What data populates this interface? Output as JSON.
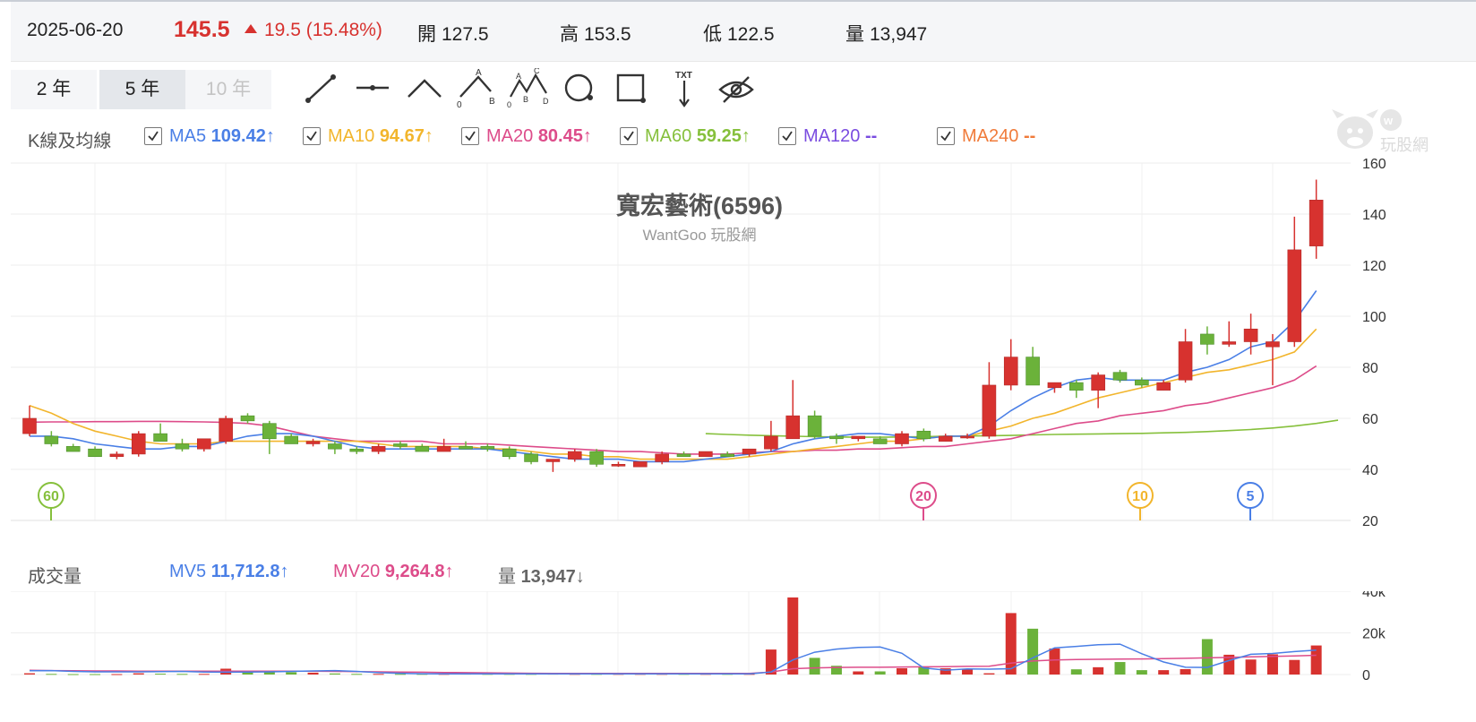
{
  "header": {
    "date": "2025-06-20",
    "price": "145.5",
    "change": "19.5 (15.48%)",
    "open_label": "開",
    "open_value": "127.5",
    "high_label": "高",
    "high_value": "153.5",
    "low_label": "低",
    "low_value": "122.5",
    "volume_label": "量",
    "volume_value": "13,947"
  },
  "range_buttons": {
    "two_year": "2 年",
    "five_year": "5 年",
    "ten_year": "10 年"
  },
  "colors": {
    "up": "#d7322f",
    "down": "#6bb23a",
    "ma5": "#4a7fe6",
    "ma10": "#f2b52c",
    "ma20": "#dd4c8a",
    "ma60": "#86c03c",
    "ma120": "#7a4ce0",
    "ma240": "#f07b3a"
  },
  "legend": {
    "title": "K線及均線",
    "ma5_label": "MA5",
    "ma5_value": "109.42",
    "ma5_arrow": "↑",
    "ma10_label": "MA10",
    "ma10_value": "94.67",
    "ma10_arrow": "↑",
    "ma20_label": "MA20",
    "ma20_value": "80.45",
    "ma20_arrow": "↑",
    "ma60_label": "MA60",
    "ma60_value": "59.25",
    "ma60_arrow": "↑",
    "ma120_label": "MA120",
    "ma120_value": "--",
    "ma240_label": "MA240",
    "ma240_value": "--"
  },
  "volume_legend": {
    "title": "成交量",
    "mv5_label": "MV5",
    "mv5_value": "11,712.8",
    "mv5_arrow": "↑",
    "mv20_label": "MV20",
    "mv20_value": "9,264.8",
    "mv20_arrow": "↑",
    "vol_label": "量",
    "vol_value": "13,947",
    "vol_arrow": "↓"
  },
  "watermark_text": "玩股網",
  "chart_data": [
    {
      "type": "candlestick",
      "title": "寬宏藝術(6596)",
      "subtitle": "WantGoo 玩股網",
      "ylim": [
        20,
        160
      ],
      "yticks": [
        20,
        40,
        60,
        80,
        100,
        120,
        140,
        160
      ],
      "ohlc": [
        {
          "o": 54,
          "h": 65,
          "l": 53,
          "c": 60
        },
        {
          "o": 53,
          "h": 55,
          "l": 49,
          "c": 50
        },
        {
          "o": 49,
          "h": 50,
          "l": 47,
          "c": 47
        },
        {
          "o": 48,
          "h": 49,
          "l": 45,
          "c": 45
        },
        {
          "o": 45,
          "h": 47,
          "l": 44,
          "c": 46
        },
        {
          "o": 46,
          "h": 55,
          "l": 45,
          "c": 54
        },
        {
          "o": 54,
          "h": 58,
          "l": 51,
          "c": 51
        },
        {
          "o": 50,
          "h": 52,
          "l": 47,
          "c": 48
        },
        {
          "o": 48,
          "h": 52,
          "l": 47,
          "c": 52
        },
        {
          "o": 51,
          "h": 61,
          "l": 50,
          "c": 60
        },
        {
          "o": 61,
          "h": 62,
          "l": 58,
          "c": 59
        },
        {
          "o": 58,
          "h": 59,
          "l": 46,
          "c": 52
        },
        {
          "o": 53,
          "h": 54,
          "l": 50,
          "c": 50
        },
        {
          "o": 50,
          "h": 52,
          "l": 49,
          "c": 51
        },
        {
          "o": 50,
          "h": 51,
          "l": 46,
          "c": 48
        },
        {
          "o": 48,
          "h": 49,
          "l": 46,
          "c": 47
        },
        {
          "o": 47,
          "h": 50,
          "l": 46,
          "c": 49
        },
        {
          "o": 50,
          "h": 51,
          "l": 48,
          "c": 49
        },
        {
          "o": 49,
          "h": 50,
          "l": 47,
          "c": 47
        },
        {
          "o": 47,
          "h": 52,
          "l": 47,
          "c": 49
        },
        {
          "o": 49,
          "h": 51,
          "l": 48,
          "c": 48
        },
        {
          "o": 49,
          "h": 50,
          "l": 47,
          "c": 48
        },
        {
          "o": 48,
          "h": 49,
          "l": 44,
          "c": 45
        },
        {
          "o": 46,
          "h": 47,
          "l": 42,
          "c": 43
        },
        {
          "o": 43,
          "h": 44,
          "l": 39,
          "c": 44
        },
        {
          "o": 44,
          "h": 48,
          "l": 43,
          "c": 47
        },
        {
          "o": 47,
          "h": 48,
          "l": 41,
          "c": 42
        },
        {
          "o": 42,
          "h": 43,
          "l": 41,
          "c": 42
        },
        {
          "o": 41,
          "h": 43,
          "l": 41,
          "c": 43
        },
        {
          "o": 43,
          "h": 47,
          "l": 42,
          "c": 46
        },
        {
          "o": 46,
          "h": 47,
          "l": 45,
          "c": 45
        },
        {
          "o": 45,
          "h": 47,
          "l": 45,
          "c": 47
        },
        {
          "o": 46,
          "h": 47,
          "l": 45,
          "c": 45
        },
        {
          "o": 46,
          "h": 48,
          "l": 45,
          "c": 48
        },
        {
          "o": 48,
          "h": 59,
          "l": 47,
          "c": 53
        },
        {
          "o": 52,
          "h": 75,
          "l": 52,
          "c": 61
        },
        {
          "o": 61,
          "h": 63,
          "l": 52,
          "c": 53
        },
        {
          "o": 53,
          "h": 54,
          "l": 50,
          "c": 52
        },
        {
          "o": 52,
          "h": 53,
          "l": 51,
          "c": 53
        },
        {
          "o": 52,
          "h": 53,
          "l": 50,
          "c": 50
        },
        {
          "o": 50,
          "h": 55,
          "l": 49,
          "c": 54
        },
        {
          "o": 55,
          "h": 56,
          "l": 51,
          "c": 52
        },
        {
          "o": 51,
          "h": 54,
          "l": 51,
          "c": 53
        },
        {
          "o": 53,
          "h": 54,
          "l": 52,
          "c": 53
        },
        {
          "o": 53,
          "h": 82,
          "l": 52,
          "c": 73
        },
        {
          "o": 73,
          "h": 91,
          "l": 71,
          "c": 84
        },
        {
          "o": 84,
          "h": 88,
          "l": 73,
          "c": 73
        },
        {
          "o": 72,
          "h": 74,
          "l": 70,
          "c": 74
        },
        {
          "o": 74,
          "h": 75,
          "l": 68,
          "c": 71
        },
        {
          "o": 71,
          "h": 78,
          "l": 64,
          "c": 77
        },
        {
          "o": 78,
          "h": 79,
          "l": 74,
          "c": 75
        },
        {
          "o": 75,
          "h": 76,
          "l": 72,
          "c": 73
        },
        {
          "o": 71,
          "h": 75,
          "l": 71,
          "c": 74
        },
        {
          "o": 75,
          "h": 95,
          "l": 74,
          "c": 90
        },
        {
          "o": 93,
          "h": 96,
          "l": 85,
          "c": 89
        },
        {
          "o": 89,
          "h": 98,
          "l": 88,
          "c": 90
        },
        {
          "o": 90,
          "h": 101,
          "l": 85,
          "c": 95
        },
        {
          "o": 88,
          "h": 93,
          "l": 73,
          "c": 90
        },
        {
          "o": 90,
          "h": 139,
          "l": 88,
          "c": 126
        },
        {
          "o": 127.5,
          "h": 153.5,
          "l": 122.5,
          "c": 145.5
        }
      ],
      "ma5": [
        53,
        53,
        52,
        50,
        49,
        48,
        48,
        49,
        49,
        51,
        53,
        54,
        54,
        53,
        51,
        49,
        48,
        48,
        48,
        48,
        48,
        48,
        47,
        46,
        45,
        44,
        44,
        44,
        43,
        43,
        43,
        44,
        45,
        46,
        47,
        50,
        52,
        53,
        54,
        54,
        53,
        52,
        53,
        53,
        57,
        63,
        68,
        72,
        75,
        76,
        75,
        75,
        75,
        78,
        80,
        83,
        88,
        90,
        98,
        110
      ],
      "ma10": [
        65,
        62,
        58,
        55,
        53,
        51,
        50,
        50,
        50,
        51,
        51,
        51,
        51,
        51,
        51,
        51,
        50,
        49,
        49,
        49,
        49,
        48,
        48,
        47,
        46,
        46,
        45,
        45,
        44,
        44,
        44,
        44,
        44,
        45,
        46,
        47,
        48,
        49,
        50,
        51,
        51,
        52,
        53,
        53,
        55,
        57,
        60,
        62,
        65,
        68,
        70,
        72,
        74,
        76,
        78,
        79,
        81,
        83,
        86,
        95
      ],
      "ma20": [
        58.5,
        58.6,
        58.6,
        58.7,
        58.7,
        58.8,
        58.8,
        58.7,
        58.6,
        58.4,
        58,
        57,
        55,
        53,
        52,
        51,
        51,
        51,
        51,
        50,
        50,
        50,
        49.5,
        49,
        48.5,
        48,
        47.5,
        47,
        47,
        46.5,
        46,
        46,
        46,
        46.5,
        47,
        47,
        47.5,
        47.5,
        48,
        48,
        48.5,
        49,
        49,
        50,
        51,
        52,
        54,
        56,
        58,
        59,
        61,
        62,
        63,
        65,
        66,
        68,
        70,
        72,
        75,
        80.5
      ],
      "ma60_start": 31,
      "ma60": [
        54,
        53.7,
        53.4,
        53.2,
        53,
        52.8,
        52.7,
        52.6,
        52.6,
        52.7,
        52.8,
        53,
        53.1,
        53.2,
        53.3,
        53.5,
        53.7,
        53.8,
        53.9,
        54,
        54.1,
        54.3,
        54.5,
        54.8,
        55.2,
        55.6,
        56.2,
        57,
        58,
        59.25
      ],
      "markers": [
        {
          "label": "60",
          "index": 1,
          "series": "ma60"
        },
        {
          "label": "20",
          "index": 41,
          "series": "ma20"
        },
        {
          "label": "10",
          "index": 51,
          "series": "ma10"
        },
        {
          "label": "5",
          "index": 56,
          "series": "ma5"
        }
      ]
    },
    {
      "type": "bar",
      "title": "成交量",
      "ylim": [
        0,
        40000
      ],
      "yticks": [
        "0",
        "20k",
        "40k"
      ],
      "volume": [
        600,
        300,
        200,
        200,
        200,
        600,
        400,
        300,
        300,
        2800,
        1300,
        1600,
        1100,
        900,
        500,
        300,
        300,
        300,
        300,
        300,
        400,
        300,
        300,
        300,
        400,
        300,
        300,
        300,
        300,
        300,
        300,
        300,
        300,
        300,
        12000,
        37000,
        8000,
        4200,
        1500,
        1500,
        3000,
        3500,
        3000,
        2500,
        600,
        29500,
        22000,
        12500,
        2500,
        3500,
        6000,
        2100,
        2100,
        2600,
        17000,
        9500,
        7200,
        9700,
        7000,
        13947
      ],
      "mv5": [
        1800,
        1900,
        1500,
        1300,
        1300,
        1300,
        1400,
        1500,
        1200,
        1100,
        1200,
        1300,
        1500,
        1700,
        1900,
        1500,
        900,
        600,
        400,
        300,
        300,
        300,
        300,
        300,
        300,
        300,
        300,
        300,
        300,
        300,
        300,
        300,
        300,
        300,
        1200,
        7000,
        10700,
        12200,
        13000,
        13200,
        10200,
        3200,
        2100,
        2700,
        2600,
        2800,
        8000,
        12800,
        13500,
        14300,
        14600,
        10000,
        6000,
        3500,
        3400,
        6700,
        9700,
        10100,
        11000,
        11712.8
      ],
      "mv20": [
        2000,
        1900,
        1800,
        1700,
        1700,
        1600,
        1600,
        1600,
        1600,
        1600,
        1600,
        1600,
        1600,
        1600,
        1500,
        1400,
        1300,
        1200,
        1100,
        1000,
        900,
        800,
        700,
        600,
        500,
        500,
        500,
        500,
        500,
        500,
        500,
        500,
        500,
        500,
        1200,
        2800,
        3200,
        3400,
        3500,
        3500,
        3600,
        3700,
        3800,
        3900,
        4000,
        5500,
        6500,
        7000,
        7200,
        7300,
        7400,
        7500,
        7600,
        7800,
        8000,
        8200,
        8500,
        8700,
        8900,
        9264.8
      ]
    }
  ]
}
